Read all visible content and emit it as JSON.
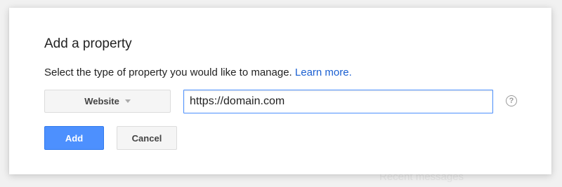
{
  "dialog": {
    "title": "Add a property",
    "prompt": "Select the type of property you would like to manage.",
    "learn_more": "Learn more.",
    "type_select": {
      "value": "Website"
    },
    "url_input": {
      "value": "https://domain.com"
    },
    "help_icon": "question-mark-icon",
    "add_label": "Add",
    "cancel_label": "Cancel"
  },
  "backdrop": {
    "text": "Recent messages"
  },
  "colors": {
    "accent": "#4d90fe",
    "link": "#1a5fd1",
    "text": "#222222"
  }
}
